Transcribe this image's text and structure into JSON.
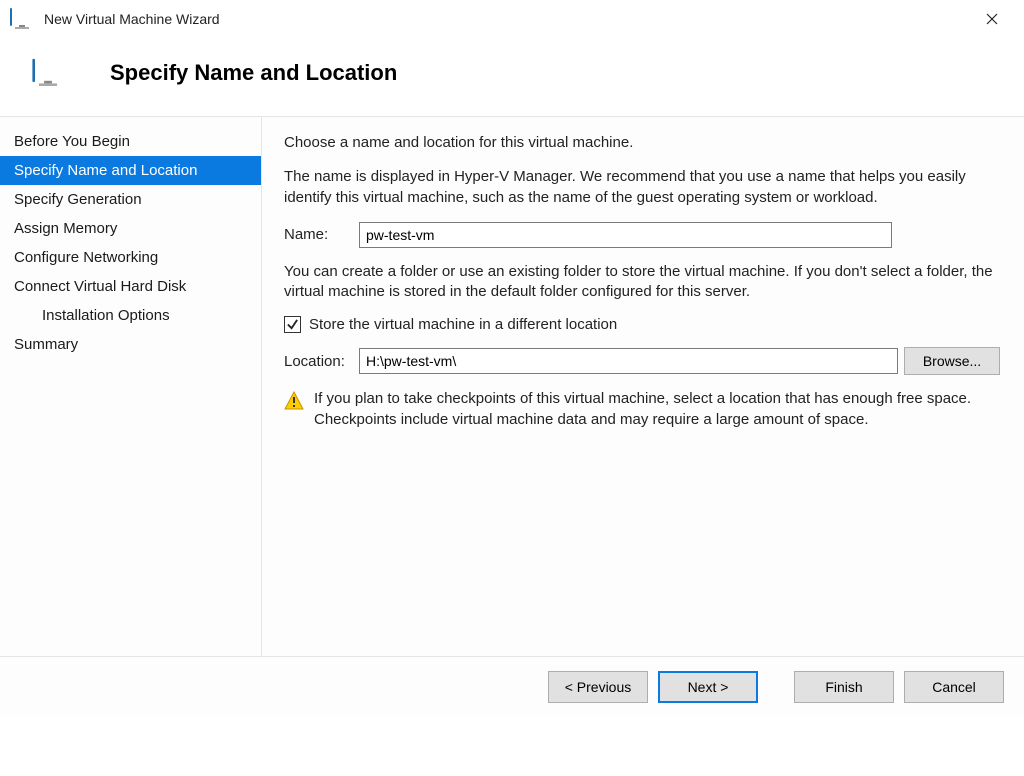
{
  "window": {
    "title": "New Virtual Machine Wizard"
  },
  "header": {
    "title": "Specify Name and Location"
  },
  "sidebar": {
    "steps": [
      {
        "label": "Before You Begin",
        "active": false,
        "indent": false
      },
      {
        "label": "Specify Name and Location",
        "active": true,
        "indent": false
      },
      {
        "label": "Specify Generation",
        "active": false,
        "indent": false
      },
      {
        "label": "Assign Memory",
        "active": false,
        "indent": false
      },
      {
        "label": "Configure Networking",
        "active": false,
        "indent": false
      },
      {
        "label": "Connect Virtual Hard Disk",
        "active": false,
        "indent": false
      },
      {
        "label": "Installation Options",
        "active": false,
        "indent": true
      },
      {
        "label": "Summary",
        "active": false,
        "indent": false
      }
    ]
  },
  "content": {
    "intro": "Choose a name and location for this virtual machine.",
    "desc": "The name is displayed in Hyper-V Manager. We recommend that you use a name that helps you easily identify this virtual machine, such as the name of the guest operating system or workload.",
    "name_label": "Name:",
    "name_value": "pw-test-vm",
    "folder_desc": "You can create a folder or use an existing folder to store the virtual machine. If you don't select a folder, the virtual machine is stored in the default folder configured for this server.",
    "store_checkbox": {
      "checked": true,
      "label": "Store the virtual machine in a different location"
    },
    "location_label": "Location:",
    "location_value": "H:\\pw-test-vm\\",
    "browse_label": "Browse...",
    "warning": "If you plan to take checkpoints of this virtual machine, select a location that has enough free space. Checkpoints include virtual machine data and may require a large amount of space."
  },
  "footer": {
    "previous": "< Previous",
    "next": "Next >",
    "finish": "Finish",
    "cancel": "Cancel"
  }
}
